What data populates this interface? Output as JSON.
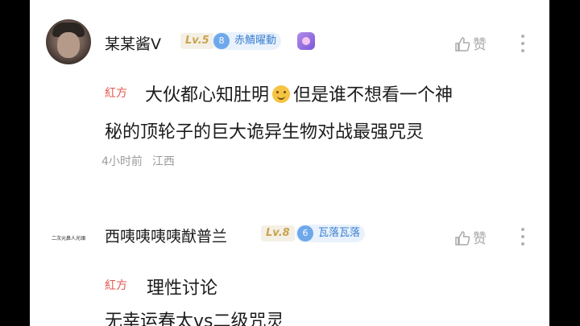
{
  "comments": [
    {
      "username": "某某酱V",
      "level": "Lv.5",
      "fan_badge": {
        "number": "8",
        "name": "赤鯖曜動"
      },
      "like_label": "赞",
      "tag": "紅方",
      "text_line1_part1": "大伙都心知肚明",
      "text_line1_part2": "但是谁不想看一个神",
      "text_line2": "秘的顶轮子的巨大诡异生物对战最强咒灵",
      "time": "4小时前",
      "location": "江西"
    },
    {
      "avatar_text": "二次元鼻人光頭",
      "username": "西咦咦咦咦猷普兰",
      "level": "Lv.8",
      "fan_badge": {
        "number": "6",
        "name": "瓦落瓦落"
      },
      "like_label": "赞",
      "tag": "紅方",
      "text_line1": "理性讨论",
      "text_line2": "无幸运春太vs二级咒灵"
    }
  ],
  "colors": {
    "accent_red": "#e4574f",
    "level_gold": "#c9a34e",
    "badge_blue": "#3a7fd0"
  }
}
